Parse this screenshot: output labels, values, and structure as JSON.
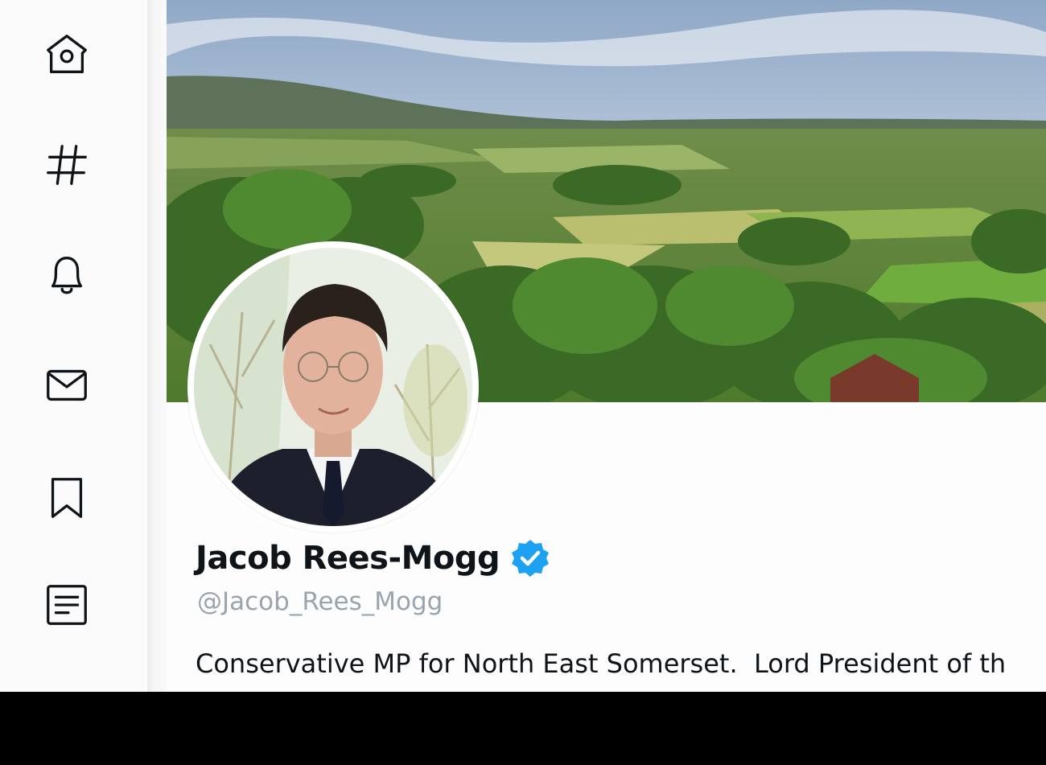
{
  "sidebar": {
    "items": [
      {
        "icon": "home-icon"
      },
      {
        "icon": "hashtag-explore-icon"
      },
      {
        "icon": "bell-notifications-icon"
      },
      {
        "icon": "envelope-messages-icon"
      },
      {
        "icon": "bookmark-icon"
      },
      {
        "icon": "list-document-icon"
      }
    ]
  },
  "banner": {
    "description_icon": "countryside-landscape-image"
  },
  "profile": {
    "display_name": "Jacob Rees-Mogg",
    "handle": "@Jacob_Rees_Mogg",
    "bio": "Conservative MP for North East Somerset.  Lord President of th",
    "verified": true,
    "verified_color": "#1da1f2"
  },
  "colors": {
    "text_primary": "#0f1419",
    "text_secondary": "#9aa4ad",
    "accent": "#1da1f2"
  }
}
